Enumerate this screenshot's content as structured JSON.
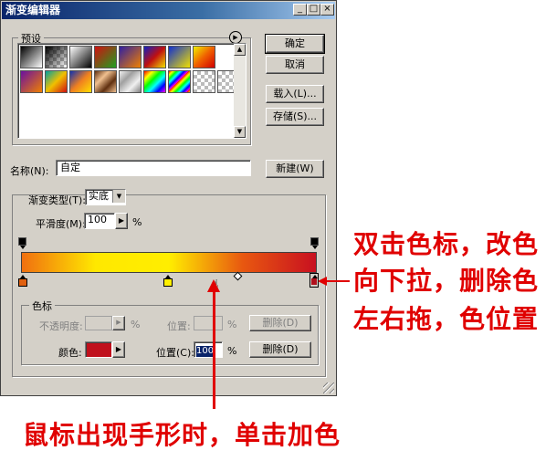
{
  "window": {
    "title": "渐变编辑器",
    "controls": [
      "_",
      "□",
      "×"
    ]
  },
  "presets": {
    "label": "预设",
    "menu_icon": "right-arrow-circle-icon"
  },
  "buttons": {
    "ok": "确定",
    "cancel": "取消",
    "load": "载入(L)...",
    "save": "存储(S)...",
    "new": "新建(W)",
    "delete_opacity": "删除(D)",
    "delete_color": "删除(D)"
  },
  "name_field": {
    "label": "名称(N):",
    "value": "自定"
  },
  "gradient_type": {
    "label": "渐变类型(T):",
    "value": "实底"
  },
  "smoothness": {
    "label": "平滑度(M):",
    "value": "100",
    "unit": "%"
  },
  "gradient": {
    "colors": [
      "#f07010",
      "#ffe800",
      "#ffee00",
      "#e85810",
      "#c81020"
    ],
    "color_stop_marker_colors": [
      "#e06010",
      "#fff000",
      "#b0101c"
    ]
  },
  "color_stops": {
    "label": "色标",
    "opacity_label": "不透明度:",
    "opacity_unit": "%",
    "position_label_disabled": "位置:",
    "position_unit_disabled": "%",
    "color_label": "颜色:",
    "color_value": "#c0101c",
    "position_label": "位置(C):",
    "position_value": "100",
    "position_unit": "%"
  },
  "annotations": {
    "right_line1": "双击色标，改色",
    "right_line2": "向下拉，删除色",
    "right_line3": "左右拖，色位置",
    "bottom": "鼠标出现手形时，单击加色",
    "color": "#e00000"
  }
}
